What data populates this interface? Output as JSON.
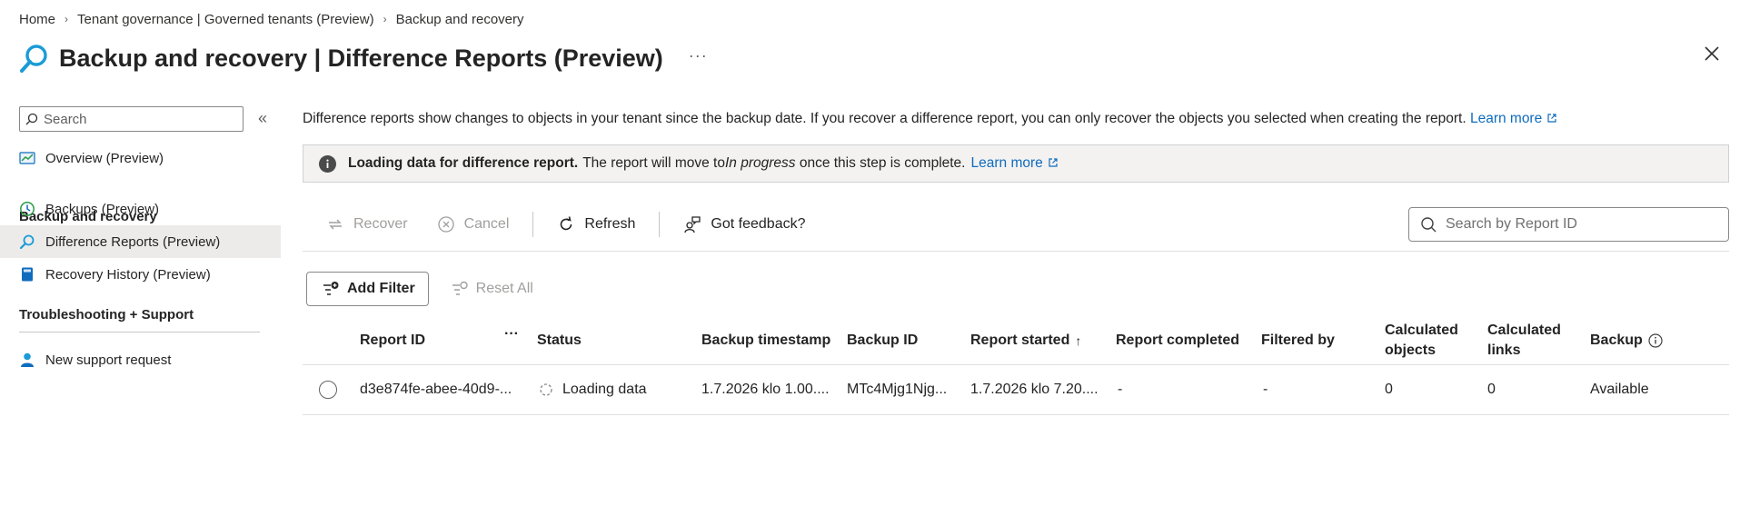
{
  "breadcrumb": [
    "Home",
    "Tenant governance | Governed tenants (Preview)",
    "Backup and recovery"
  ],
  "header": {
    "title_bold": "Backup and recovery",
    "title_rest": " | Difference Reports (Preview)",
    "more": "···"
  },
  "sidebar": {
    "search_placeholder": "Search",
    "collapse": "«",
    "overview": "Overview (Preview)",
    "group_backup": "Backup and recovery",
    "items": [
      "Backups (Preview)",
      "Difference Reports (Preview)",
      "Recovery History (Preview)"
    ],
    "group_support": "Troubleshooting + Support",
    "support_item": "New support request"
  },
  "main": {
    "description": "Difference reports show changes to objects in your tenant since the backup date. If you recover a difference report, you can only recover the objects you selected when creating the report.",
    "learn_more": "Learn more",
    "info": {
      "bold": "Loading data for difference report.",
      "text_before": "The report will move to ",
      "italic": "In progress",
      "text_after": " once this step is complete.",
      "learn_more": "Learn more"
    },
    "toolbar": {
      "recover": "Recover",
      "cancel": "Cancel",
      "refresh": "Refresh",
      "feedback": "Got feedback?",
      "search_placeholder": "Search by Report ID"
    },
    "filters": {
      "add_filter": "Add Filter",
      "reset_all": "Reset All"
    },
    "table": {
      "columns": [
        "Report ID",
        "Status",
        "Backup timestamp",
        "Backup ID",
        "Report started",
        "Report completed",
        "Filtered by",
        "Calculated objects",
        "Calculated links",
        "Backup"
      ],
      "column_more": "···",
      "rows": [
        {
          "report_id": "d3e874fe-abee-40d9-...",
          "status": "Loading data",
          "backup_timestamp": "1.7.2026 klo 1.00....",
          "backup_id": "MTc4Mjg1Njg...",
          "report_started": "1.7.2026 klo 7.20....",
          "report_completed": "-",
          "filtered_by": "-",
          "calculated_objects": "0",
          "calculated_links": "0",
          "backup": "Available"
        }
      ]
    }
  },
  "colors": {
    "accent": "#0f6cbd",
    "disabled": "#a19f9d",
    "info_bg": "#f3f2f1"
  }
}
